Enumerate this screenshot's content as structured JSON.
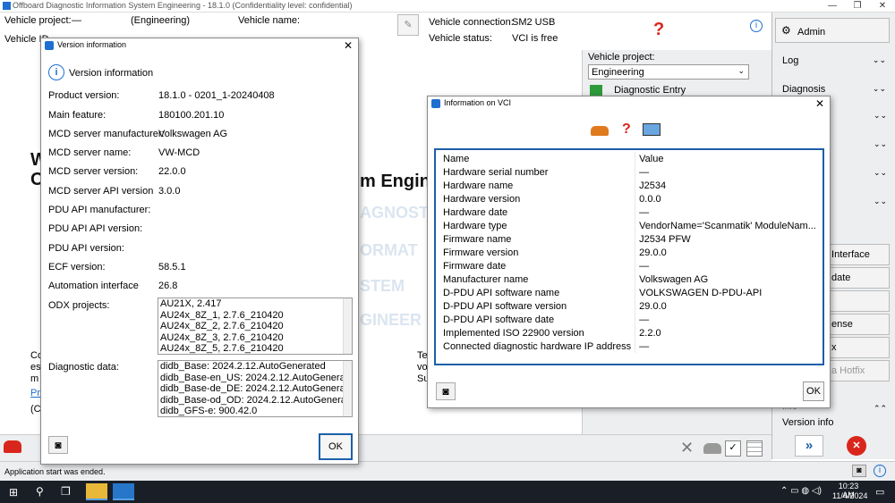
{
  "window": {
    "title": "Offboard Diagnostic Information System Engineering - 18.1.0 (Confidentiality level: confidential)",
    "min": "—",
    "max": "❐",
    "close": "✕"
  },
  "header": {
    "vehicle_project_label": "Vehicle project:",
    "vehicle_project_value": "—",
    "engineering": "(Engineering)",
    "vehicle_name_label": "Vehicle name:",
    "vehicle_id_label": "Vehicle ID",
    "connection_label": "Vehicle connection:",
    "connection_value": "SM2 USB",
    "status_label": "Vehicle status:",
    "status_value": "VCI is free"
  },
  "right_panel": {
    "admin": "Admin",
    "items": [
      "Log",
      "Diagnosis"
    ],
    "partial": [
      "tic Interface",
      "date",
      "ense",
      "x",
      "a Hotfix"
    ],
    "info": "Info",
    "version_info": "Version info"
  },
  "mid_panel": {
    "vehicle_project_label": "Vehicle project:",
    "vehicle_project_select": "Engineering",
    "diagnostic_entry": "Diagnostic Entry"
  },
  "background": {
    "w": "W",
    "o": "O",
    "m_engin": "m Engin",
    "ghost1": "AGNOST",
    "ghost2": "ORMAT",
    "ghost3": "STEM",
    "ghost4": "GINEER",
    "co": "Co",
    "es": "es",
    "m": "m",
    "pri": "Pri",
    "c": "(C",
    "te": "Te",
    "vo": "vo",
    "su": "Su"
  },
  "version_dialog": {
    "title": "Version information",
    "heading": "Version information",
    "rows": [
      {
        "label": "Product version:",
        "value": "18.1.0  -  0201_1-20240408"
      },
      {
        "label": "Main feature:",
        "value": "180100.201.10"
      },
      {
        "label": "MCD server manufacturer:",
        "value": "Volkswagen AG"
      },
      {
        "label": "MCD server name:",
        "value": "VW-MCD"
      },
      {
        "label": "MCD server version:",
        "value": "22.0.0"
      },
      {
        "label": "MCD server API version",
        "value": "3.0.0"
      },
      {
        "label": "PDU API manufacturer:",
        "value": ""
      },
      {
        "label": "PDU API API version:",
        "value": ""
      },
      {
        "label": "PDU API version:",
        "value": ""
      },
      {
        "label": "ECF version:",
        "value": "58.5.1"
      },
      {
        "label": "Automation interface",
        "value": "26.8"
      }
    ],
    "odx_label": "ODX projects:",
    "odx_items": [
      "AU21X, 2.417",
      "AU24x_8Z_1, 2.7.6_210420",
      "AU24x_8Z_2, 2.7.6_210420",
      "AU24x_8Z_3, 2.7.6_210420",
      "AU24x_8Z_5, 2.7.6_210420"
    ],
    "diag_label": "Diagnostic data:",
    "diag_items": [
      "didb_Base: 2024.2.12.AutoGenerated",
      "didb_Base-en_US: 2024.2.12.AutoGenerated",
      "didb_Base-de_DE: 2024.2.12.AutoGenerated",
      "didb_Base-od_OD: 2024.2.12.AutoGenerated",
      "didb_GFS-e: 900.42.0"
    ],
    "ok": "OK"
  },
  "vci_dialog": {
    "title": "Information on VCI",
    "columns": [
      "Name",
      "Value"
    ],
    "rows": [
      [
        "Hardware serial number",
        "—"
      ],
      [
        "Hardware name",
        "J2534"
      ],
      [
        "Hardware version",
        "0.0.0"
      ],
      [
        "Hardware date",
        "—"
      ],
      [
        "Hardware type",
        "VendorName='Scanmatik' ModuleNam..."
      ],
      [
        "Firmware name",
        "J2534 PFW"
      ],
      [
        "Firmware version",
        "29.0.0"
      ],
      [
        "Firmware date",
        "—"
      ],
      [
        "Manufacturer name",
        "Volkswagen AG"
      ],
      [
        "D-PDU API software name",
        "VOLKSWAGEN D-PDU-API"
      ],
      [
        "D-PDU API software version",
        "29.0.0"
      ],
      [
        "D-PDU API software date",
        "—"
      ],
      [
        "Implemented ISO 22900 version",
        "2.2.0"
      ],
      [
        "Connected diagnostic hardware IP address",
        "—"
      ]
    ],
    "ok": "OK"
  },
  "statusbar": {
    "message": "Application start was ended."
  },
  "taskbar": {
    "time": "10:23 AM",
    "date": "11/4/2024"
  },
  "colors": {
    "accent": "#1c5fa8",
    "taskbar": "#1a1f27",
    "panel": "#eceef0",
    "stop": "#d9261c"
  }
}
